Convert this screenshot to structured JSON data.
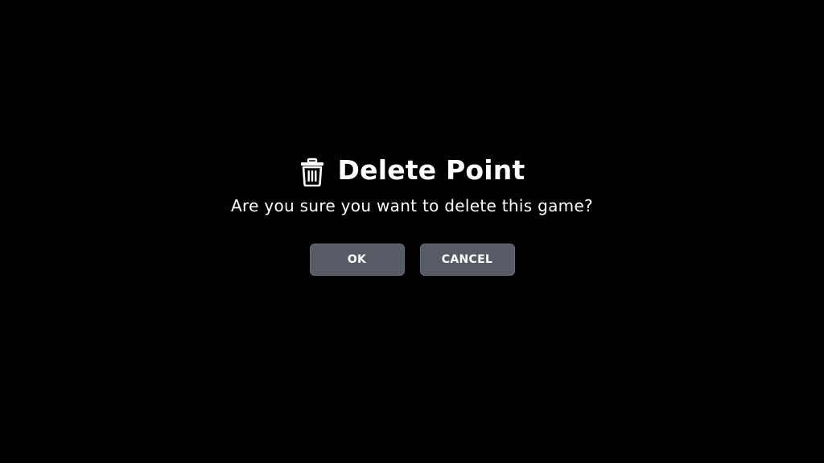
{
  "dialog": {
    "icon": "trash-icon",
    "title": "Delete Point",
    "message": "Are you sure you want to delete this game?",
    "ok_label": "OK",
    "cancel_label": "CANCEL"
  },
  "colors": {
    "background": "#000000",
    "text": "#ffffff",
    "button_background": "#565b65",
    "button_border": "#6a6f79"
  }
}
